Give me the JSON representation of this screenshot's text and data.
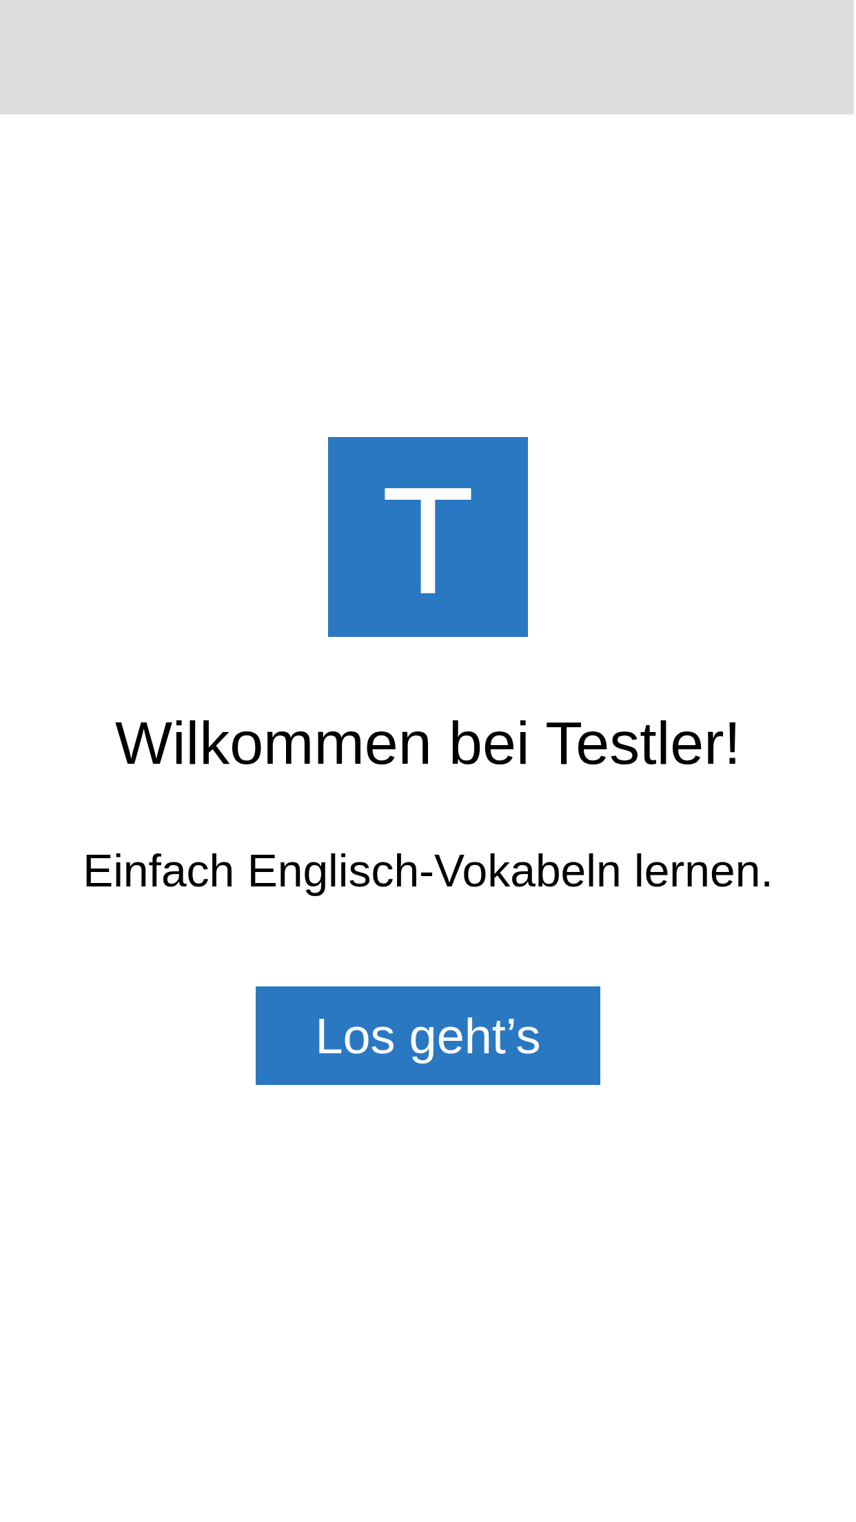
{
  "logo": {
    "letter": "T"
  },
  "title": "Wilkommen bei Testler!",
  "subtitle": "Einfach Englisch-Vokabeln lernen.",
  "start_button": {
    "label": "Los geht’s"
  }
}
